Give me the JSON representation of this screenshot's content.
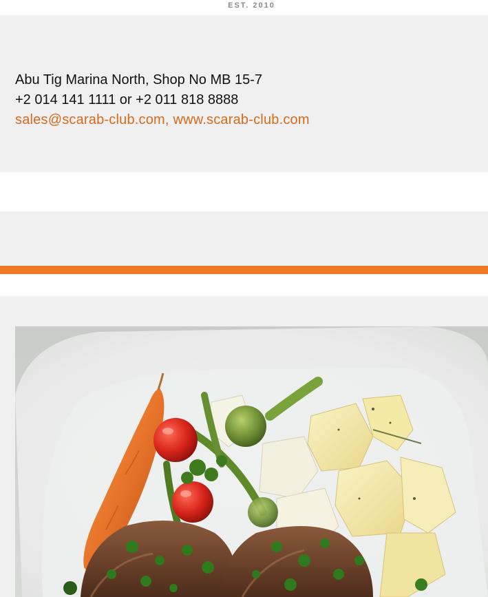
{
  "header": {
    "est_label": "EST. 2010"
  },
  "contact": {
    "address": "Abu Tig Marina North, Shop No MB 15-7",
    "phones": "+2 014 141 1111 or +2 011 818 8888",
    "email": "sales@scarab-club.com",
    "separator": ", ",
    "website": "www.scarab-club.com"
  },
  "colors": {
    "accent": "#f07924",
    "link": "#d86a1c",
    "panel_background": "#eff0ef"
  },
  "photo": {
    "subject_icon": "food-plate-image"
  }
}
